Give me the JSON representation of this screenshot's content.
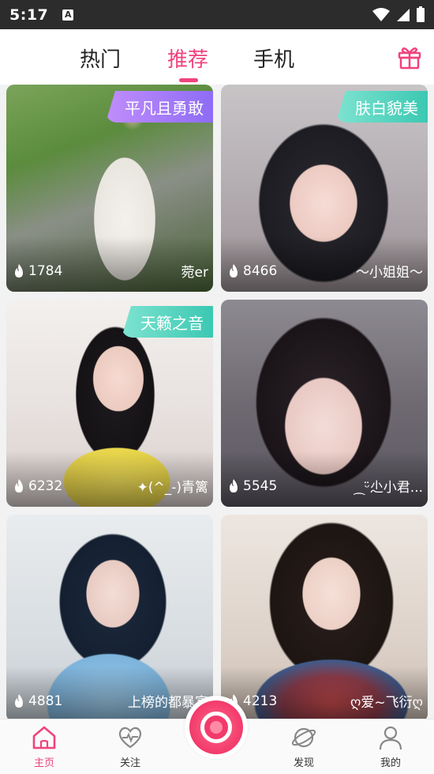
{
  "status_bar": {
    "time": "5:17",
    "notification_icon": "A"
  },
  "tabs": [
    {
      "label": "热门",
      "active": false
    },
    {
      "label": "推荐",
      "active": true
    },
    {
      "label": "手机",
      "active": false
    }
  ],
  "accent_color": "#f0437c",
  "cards": [
    {
      "badge": "平凡且勇敢",
      "badge_style": "purple",
      "count": "1784",
      "name": "菀er"
    },
    {
      "badge": "肤白貌美",
      "badge_style": "teal",
      "count": "8466",
      "name": "～小姐姐～"
    },
    {
      "badge": "天籁之音",
      "badge_style": "teal",
      "count": "6232",
      "name": "✦(^_-)青篱"
    },
    {
      "badge": "",
      "badge_style": "",
      "count": "5545",
      "name": "⁔ᵕ̈尐小君..."
    },
    {
      "badge": "",
      "badge_style": "",
      "count": "4881",
      "name": "上榜的都暴富"
    },
    {
      "badge": "",
      "badge_style": "",
      "count": "4213",
      "name": "ღ爱~飞衍ღ"
    }
  ],
  "bottom_nav": [
    {
      "label": "主页",
      "icon": "home-icon",
      "active": true
    },
    {
      "label": "关注",
      "icon": "heart-pulse-icon",
      "active": false
    },
    {
      "label": "",
      "icon": "live-camera-icon",
      "active": false
    },
    {
      "label": "发现",
      "icon": "planet-icon",
      "active": false
    },
    {
      "label": "我的",
      "icon": "user-icon",
      "active": false
    }
  ]
}
